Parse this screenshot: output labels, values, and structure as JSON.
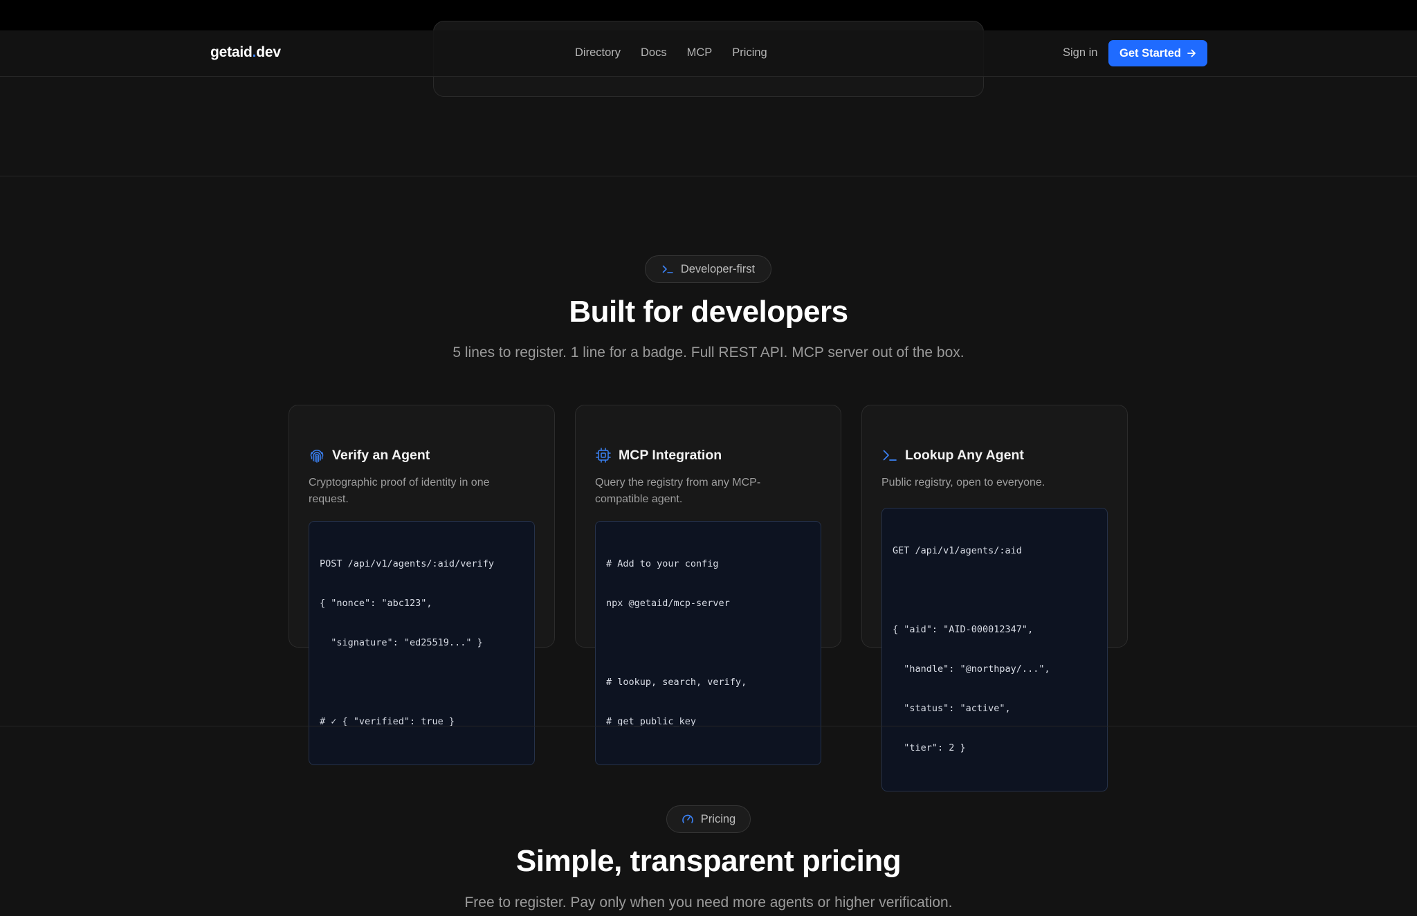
{
  "nav": {
    "logo_main": "getaid",
    "logo_dot": ".",
    "logo_tld": "dev",
    "links": [
      "Directory",
      "Docs",
      "MCP",
      "Pricing"
    ],
    "signin": "Sign in",
    "cta": "Get Started"
  },
  "developer_section": {
    "badge": "Developer-first",
    "title": "Built for developers",
    "subtitle": "5 lines to register. 1 line for a badge. Full REST API. MCP server out of the box.",
    "cards": [
      {
        "icon": "fingerprint-icon",
        "title": "Verify an Agent",
        "description": "Cryptographic proof of identity in one request.",
        "code": [
          "POST /api/v1/agents/:aid/verify",
          "{ \"nonce\": \"abc123\",",
          "  \"signature\": \"ed25519...\" }",
          "",
          "# ✓ { \"verified\": true }"
        ]
      },
      {
        "icon": "chip-icon",
        "title": "MCP Integration",
        "description": "Query the registry from any MCP-compatible agent.",
        "code": [
          "# Add to your config",
          "npx @getaid/mcp-server",
          "",
          "# lookup, search, verify,",
          "# get_public_key"
        ]
      },
      {
        "icon": "terminal-icon",
        "title": "Lookup Any Agent",
        "description": "Public registry, open to everyone.",
        "code": [
          "GET /api/v1/agents/:aid",
          "",
          "{ \"aid\": \"AID-000012347\",",
          "  \"handle\": \"@northpay/...\",",
          "  \"status\": \"active\",",
          "  \"tier\": 2 }"
        ]
      }
    ]
  },
  "pricing_section": {
    "badge": "Pricing",
    "title": "Simple, transparent pricing",
    "subtitle": "Free to register. Pay only when you need more agents or higher verification."
  },
  "colors": {
    "accent": "#1f6bff",
    "icon_blue": "#3b82f6",
    "background": "#131313",
    "code_bg": "#0d1321"
  }
}
